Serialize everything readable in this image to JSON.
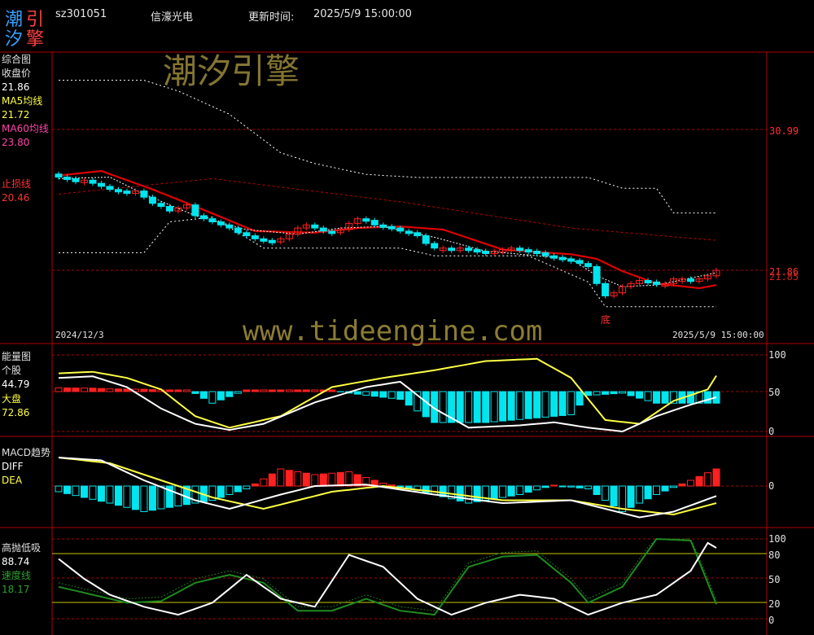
{
  "header": {
    "logo_chars": [
      "潮",
      "引",
      "汐",
      "擎"
    ],
    "code": "sz301051",
    "name": "信濠光电",
    "update_label": "更新时间:",
    "update_time": "2025/5/9 15:00:00"
  },
  "watermark": {
    "top": "潮汐引擎",
    "url": "www.tideengine.com"
  },
  "panel_main": {
    "title": "综合图",
    "close_label": "收盘价",
    "close_value": "21.86",
    "ma5_label": "MA5均线",
    "ma5_value": "21.72",
    "ma60_label": "MA60均线",
    "ma60_value": "23.80",
    "stop_label": "止损线",
    "stop_value": "20.46",
    "right_label_top": "30.99",
    "right_label_bottom": "21.86",
    "right_label_bottom2": "21.85",
    "date_start": "2024/12/3",
    "date_end": "2025/5/9 15:00:00",
    "bottom_marker": "底"
  },
  "panel_energy": {
    "title": "能量图",
    "stock_label": "个股",
    "stock_value": "44.79",
    "market_label": "大盘",
    "market_value": "72.86",
    "axis": [
      "100",
      "50",
      "0"
    ]
  },
  "panel_macd": {
    "title": "MACD趋势",
    "diff_label": "DIFF",
    "dea_label": "DEA",
    "axis": [
      "0"
    ]
  },
  "panel_osc": {
    "title": "高抛低吸",
    "value": "88.74",
    "speed_label": "速度线",
    "speed_value": "18.17",
    "axis": [
      "100",
      "80",
      "50",
      "20",
      "0"
    ]
  },
  "colors": {
    "up": "#ff2020",
    "down": "#00e5ee",
    "ma60": "#d00000",
    "stop": "#ffffff",
    "white_line": "#ffffff",
    "yellow_line": "#ffff44",
    "green_line": "#1f7a1f",
    "grid_red": "#b00000",
    "yellow_grid": "#c8c800",
    "watermark": "#9b8a3a"
  },
  "chart_data": {
    "type": "candlestick",
    "main_close_approx": [
      27.9,
      27.8,
      27.6,
      27.7,
      27.5,
      27.3,
      27.1,
      27.0,
      26.9,
      27.0,
      26.6,
      26.2,
      26.0,
      25.7,
      25.9,
      26.1,
      25.4,
      25.2,
      25.0,
      24.8,
      24.6,
      24.3,
      24.1,
      23.9,
      23.8,
      23.7,
      23.9,
      24.2,
      24.6,
      24.8,
      24.6,
      24.4,
      24.3,
      24.5,
      24.9,
      25.2,
      25.1,
      24.8,
      24.7,
      24.6,
      24.4,
      24.3,
      24.1,
      23.6,
      23.3,
      23.3,
      23.2,
      23.3,
      23.2,
      23.1,
      23.0,
      23.1,
      23.2,
      23.3,
      23.2,
      23.1,
      23.0,
      22.8,
      22.7,
      22.6,
      22.5,
      22.3,
      22.1,
      21.0,
      20.2,
      20.4,
      20.8,
      21.0,
      21.2,
      21.1,
      21.0,
      21.0,
      21.3,
      21.3,
      21.2,
      21.3,
      21.5,
      21.86
    ],
    "energy_stock_last": 44.79,
    "energy_market_last": 72.86,
    "osc_last": 88.74,
    "speed_last": 18.17
  }
}
